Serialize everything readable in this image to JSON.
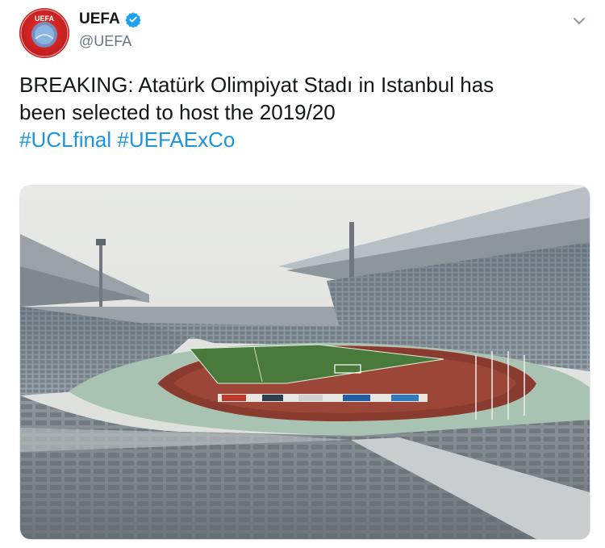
{
  "account": {
    "display_name": "UEFA",
    "handle": "@UEFA",
    "verified": true,
    "avatar_text": "UEFA",
    "avatar_icon": "uefa-logo"
  },
  "tweet": {
    "line1": "BREAKING: Atatürk Olimpiyat Stadı in Istanbul has",
    "line2": "been selected to host the 2019/20",
    "hashtags": [
      "#UCLfinal",
      "#UEFAExCo"
    ]
  },
  "media": {
    "image_subject": "stadium-photo"
  },
  "colors": {
    "link": "#1b95e0",
    "text": "#14171a",
    "secondary": "#657786",
    "verified": "#1da1f2"
  }
}
